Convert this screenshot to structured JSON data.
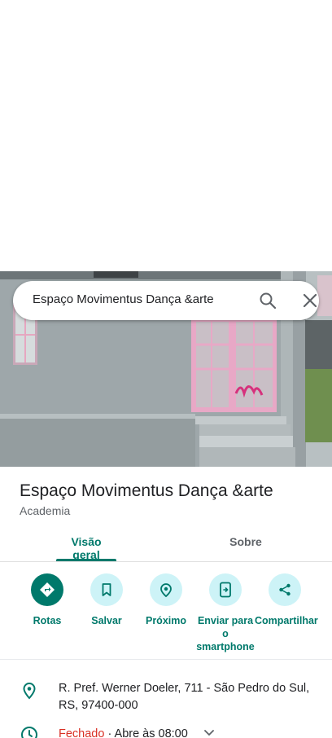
{
  "search": {
    "query": "Espaço Movimentus Dança &arte"
  },
  "place": {
    "name": "Espaço Movimentus Dança &arte",
    "category": "Academia"
  },
  "tabs": [
    {
      "label": "Visão geral",
      "active": true
    },
    {
      "label": "Sobre",
      "active": false
    }
  ],
  "actions": [
    {
      "label": "Rotas",
      "icon": "directions-icon"
    },
    {
      "label": "Salvar",
      "icon": "bookmark-icon"
    },
    {
      "label": "Próximo",
      "icon": "nearby-icon"
    },
    {
      "label": "Enviar para o smartphone",
      "icon": "send-to-phone-icon"
    },
    {
      "label": "Compartilhar",
      "icon": "share-icon"
    }
  ],
  "info": {
    "address": "R. Pref. Werner Doeler, 711 - São Pedro do Sul, RS, 97400-000",
    "hours_status": "Fechado",
    "hours_detail": " · Abre às 08:00"
  },
  "colors": {
    "accent": "#00796b",
    "action_bg": "#cdf3f7",
    "closed": "#d93025"
  }
}
